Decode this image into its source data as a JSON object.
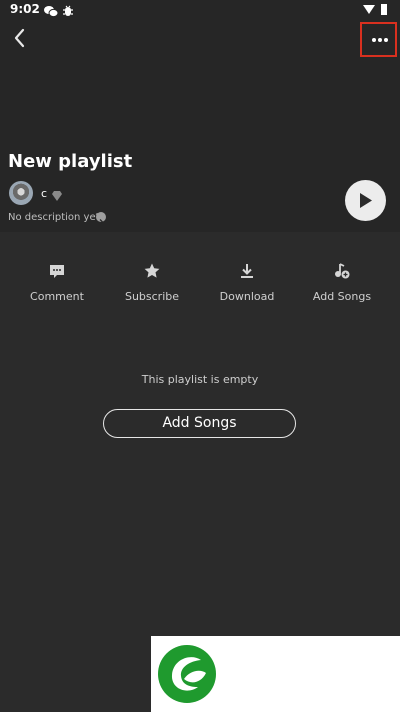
{
  "status_bar": {
    "time": "9:02"
  },
  "playlist": {
    "title": "New playlist",
    "user_name": "c",
    "description": "No description yet"
  },
  "actions": [
    {
      "label": "Comment",
      "icon": "comment-icon"
    },
    {
      "label": "Subscribe",
      "icon": "star-icon"
    },
    {
      "label": "Download",
      "icon": "download-icon"
    },
    {
      "label": "Add Songs",
      "icon": "add-music-icon"
    }
  ],
  "empty_state": {
    "message": "This playlist is empty",
    "button_label": "Add Songs"
  },
  "colors": {
    "background": "#2b2b2b",
    "highlight_border": "#d9301f",
    "logo_green": "#1f9a2e"
  }
}
